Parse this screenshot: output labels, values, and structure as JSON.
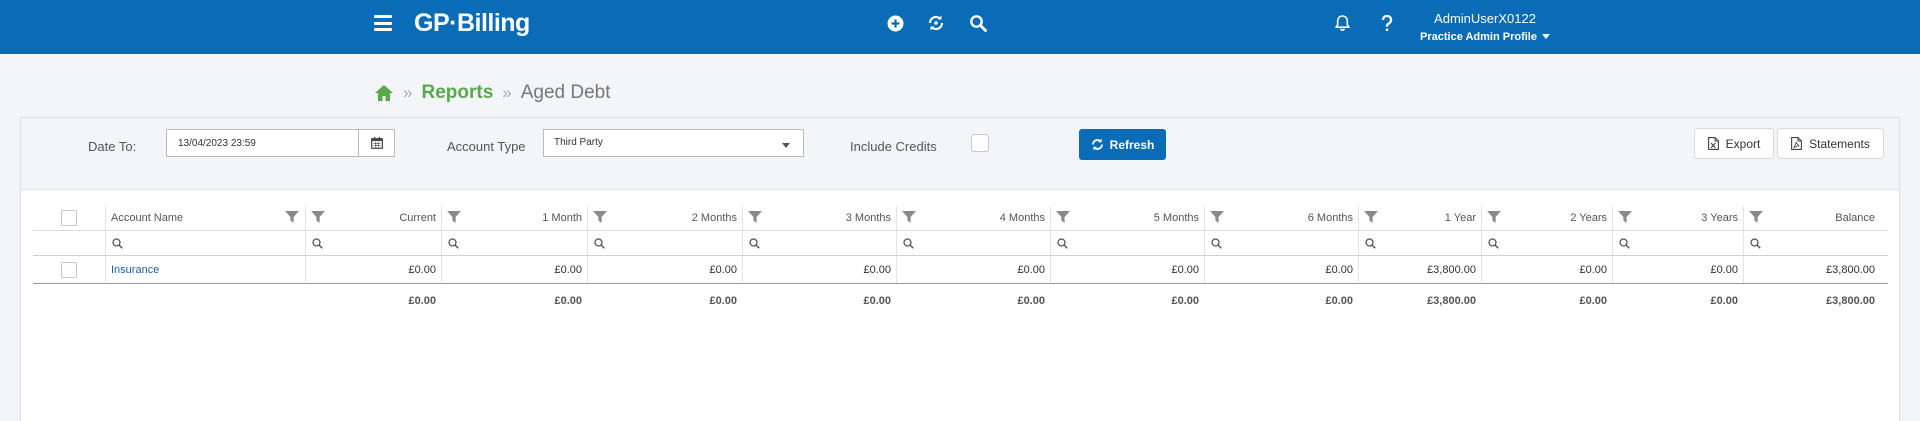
{
  "header": {
    "logo": "GP·Billing",
    "user_name": "AdminUserX0122",
    "profile": "Practice Admin Profile"
  },
  "breadcrumb": {
    "reports": "Reports",
    "current": "Aged Debt",
    "separator": "»"
  },
  "filters": {
    "date_label": "Date To:",
    "date_value": "13/04/2023 23:59",
    "account_type_label": "Account Type",
    "account_type_value": "Third Party",
    "include_credits_label": "Include Credits",
    "refresh_label": "Refresh",
    "export_label": "Export",
    "statements_label": "Statements"
  },
  "table": {
    "columns": [
      "Account Name",
      "Current",
      "1 Month",
      "2 Months",
      "3 Months",
      "4 Months",
      "5 Months",
      "6 Months",
      "1 Year",
      "2 Years",
      "3 Years",
      "Balance"
    ],
    "rows": [
      [
        "Insurance",
        "£0.00",
        "£0.00",
        "£0.00",
        "£0.00",
        "£0.00",
        "£0.00",
        "£0.00",
        "£3,800.00",
        "£0.00",
        "£0.00",
        "£3,800.00"
      ]
    ],
    "totals": [
      "£0.00",
      "£0.00",
      "£0.00",
      "£0.00",
      "£0.00",
      "£0.00",
      "£0.00",
      "£3,800.00",
      "£0.00",
      "£0.00",
      "£3,800.00"
    ]
  },
  "colors": {
    "brand_blue": "#0a6cb6",
    "breadcrumb_green": "#59a84a",
    "link_blue": "#1a63b0"
  }
}
